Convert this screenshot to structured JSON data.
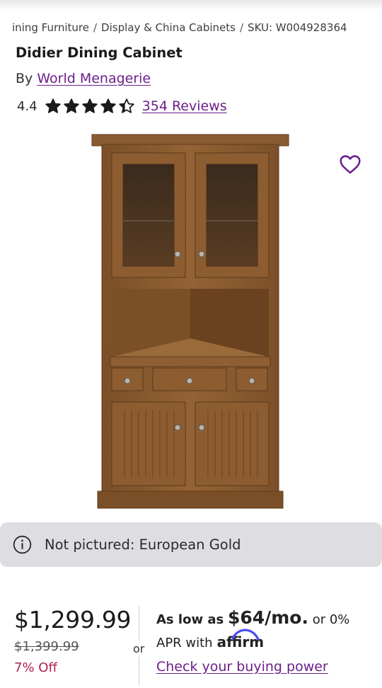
{
  "breadcrumb": {
    "items": [
      "ining Furniture",
      "Display & China Cabinets",
      "SKU: W004928364"
    ],
    "separator": "/"
  },
  "product": {
    "title": "Didier Dining Cabinet",
    "by_prefix": "By",
    "brand": "World Menagerie",
    "rating": "4.4",
    "rating_value": 4.4,
    "reviews_label": "354 Reviews"
  },
  "icons": {
    "wishlist": "heart-outline-icon",
    "star": "star-icon",
    "info": "info-circle-icon"
  },
  "banner": {
    "text": "Not pictured: European Gold"
  },
  "pricing": {
    "current": "$1,299.99",
    "original": "$1,399.99",
    "discount": "7% Off",
    "or_label": "or",
    "financing_prefix": "As low as",
    "financing_amount": "$64/mo.",
    "financing_suffix": "or 0%",
    "apr_text": "APR with",
    "affirm_brand": "affirm",
    "check_link": "Check your buying power"
  },
  "colors": {
    "link_purple": "#6b1f8a",
    "sale_red": "#b2234e",
    "star": "#1a1a1a",
    "banner_bg": "#dedee2",
    "affirm_blue": "#4a4af4"
  }
}
